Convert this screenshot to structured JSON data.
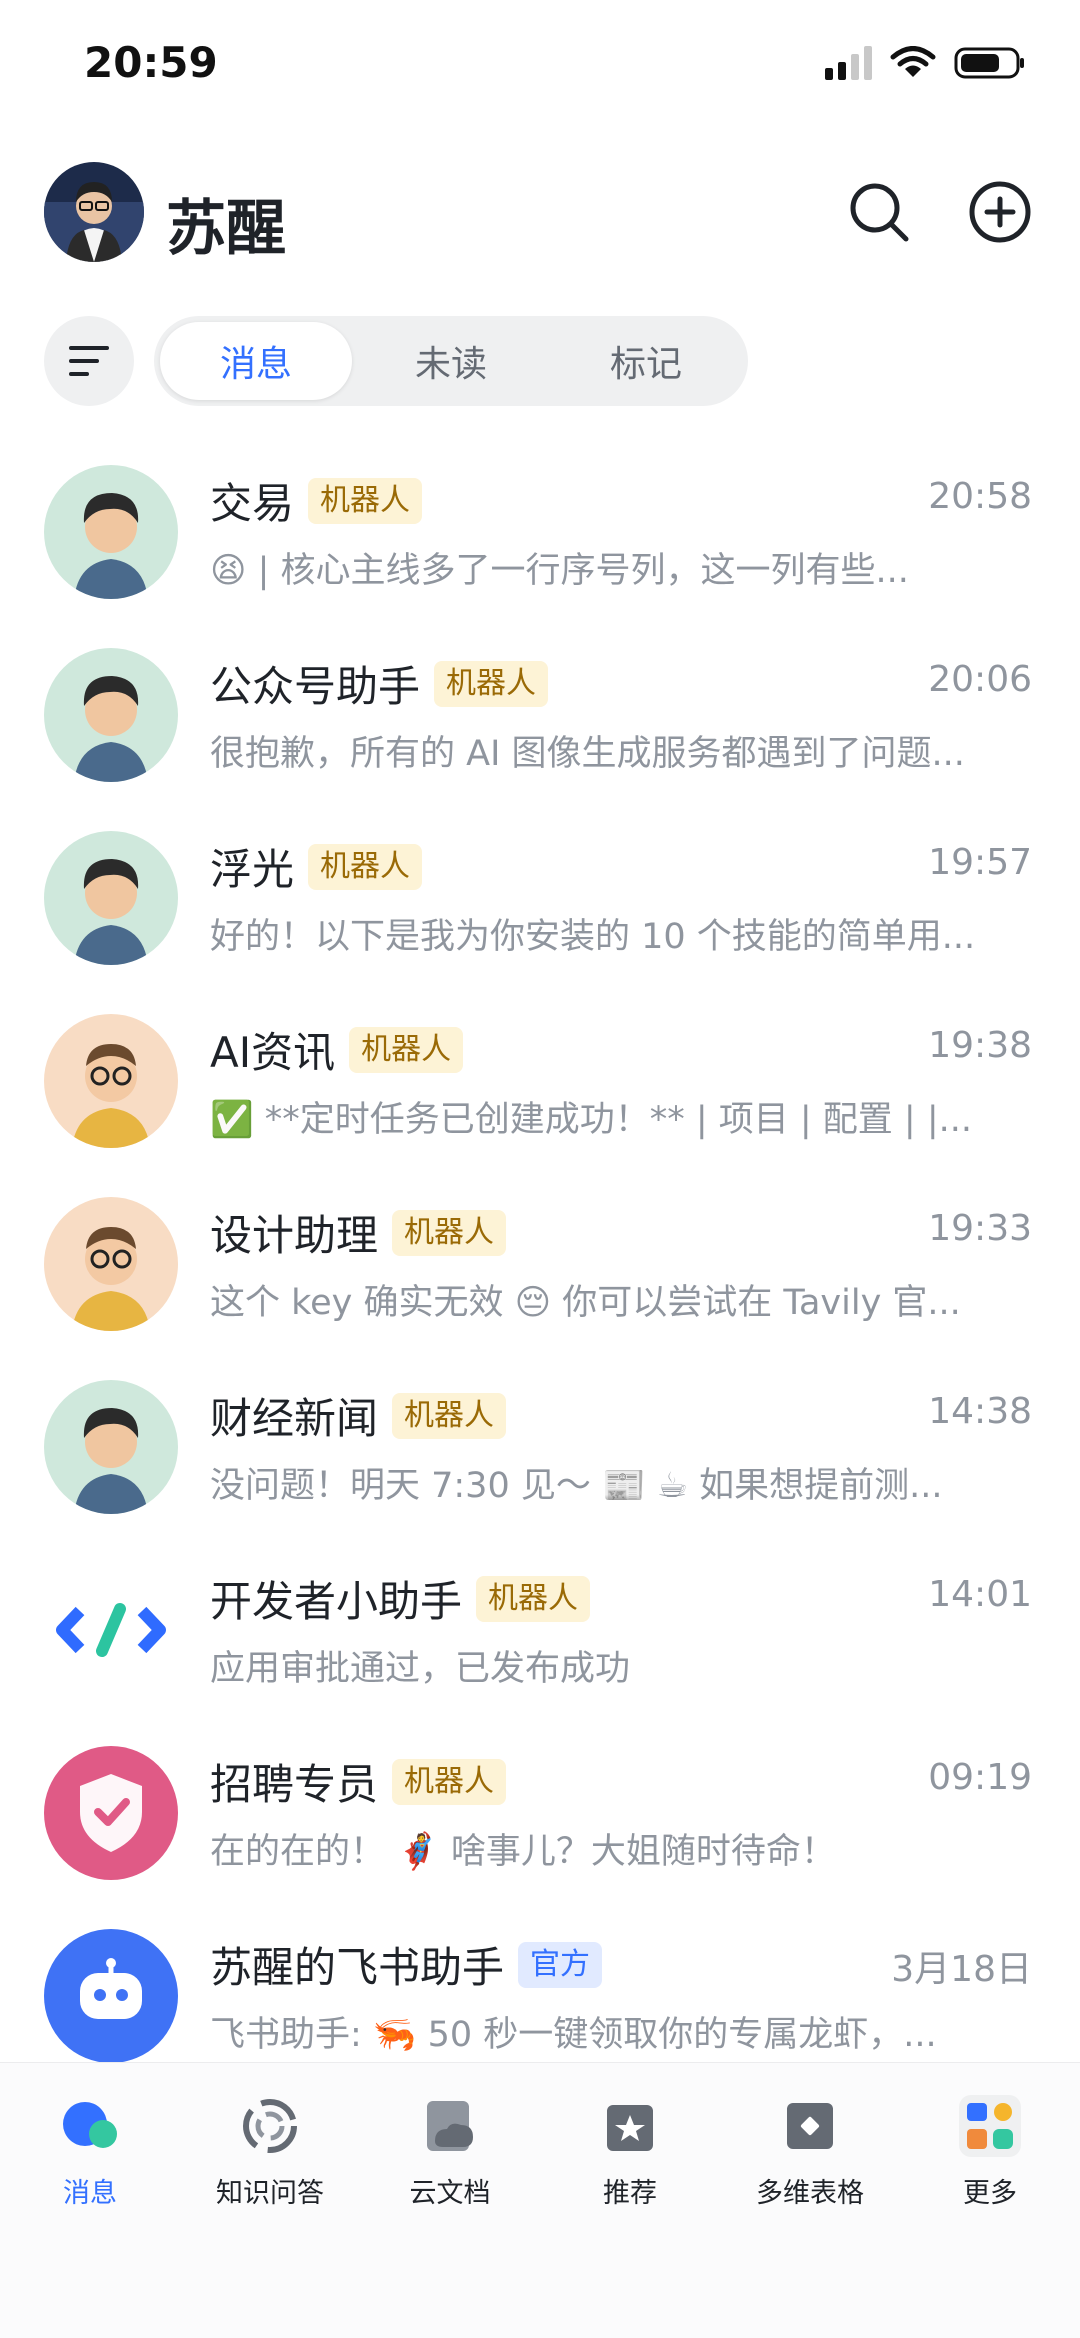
{
  "status_bar": {
    "time": "20:59"
  },
  "header": {
    "user_name": "苏醒"
  },
  "filters": {
    "tabs": [
      "消息",
      "未读",
      "标记"
    ],
    "active": "消息"
  },
  "chats": [
    {
      "name": "交易",
      "tag": "机器人",
      "time": "20:58",
      "preview": "😫 | 核心主线多了一行序号列，这一列有些..."
    },
    {
      "name": "公众号助手",
      "tag": "机器人",
      "time": "20:06",
      "preview": "很抱歉，所有的 AI 图像生成服务都遇到了问题..."
    },
    {
      "name": "浮光",
      "tag": "机器人",
      "time": "19:57",
      "preview": "好的！以下是我为你安装的 10 个技能的简单用..."
    },
    {
      "name": "AI资讯",
      "tag": "机器人",
      "time": "19:38",
      "preview": "✅ **定时任务已创建成功！** | 项目 | 配置 | |..."
    },
    {
      "name": "设计助理",
      "tag": "机器人",
      "time": "19:33",
      "preview": "这个 key 确实无效 😔 你可以尝试在 Tavily 官..."
    },
    {
      "name": "财经新闻",
      "tag": "机器人",
      "time": "14:38",
      "preview": "没问题！明天 7:30 见～ 📰 ☕ 如果想提前测..."
    },
    {
      "name": "开发者小助手",
      "tag": "机器人",
      "time": "14:01",
      "preview": "应用审批通过，已发布成功"
    },
    {
      "name": "招聘专员",
      "tag": "机器人",
      "time": "09:19",
      "preview": "在的在的！ 🦸 啥事儿？大姐随时待命！"
    },
    {
      "name": "苏醒的飞书助手",
      "tag": "官方",
      "time": "3月18日",
      "preview": "飞书助手: 🦐 50 秒一键领取你的专属龙虾，..."
    }
  ],
  "bottom_nav": [
    "消息",
    "知识问答",
    "云文档",
    "推荐",
    "多维表格",
    "更多"
  ],
  "colors": {
    "accent": "#3370ff",
    "bot_tag_bg": "#fdf3d6",
    "official_tag_bg": "#e1eaff"
  }
}
